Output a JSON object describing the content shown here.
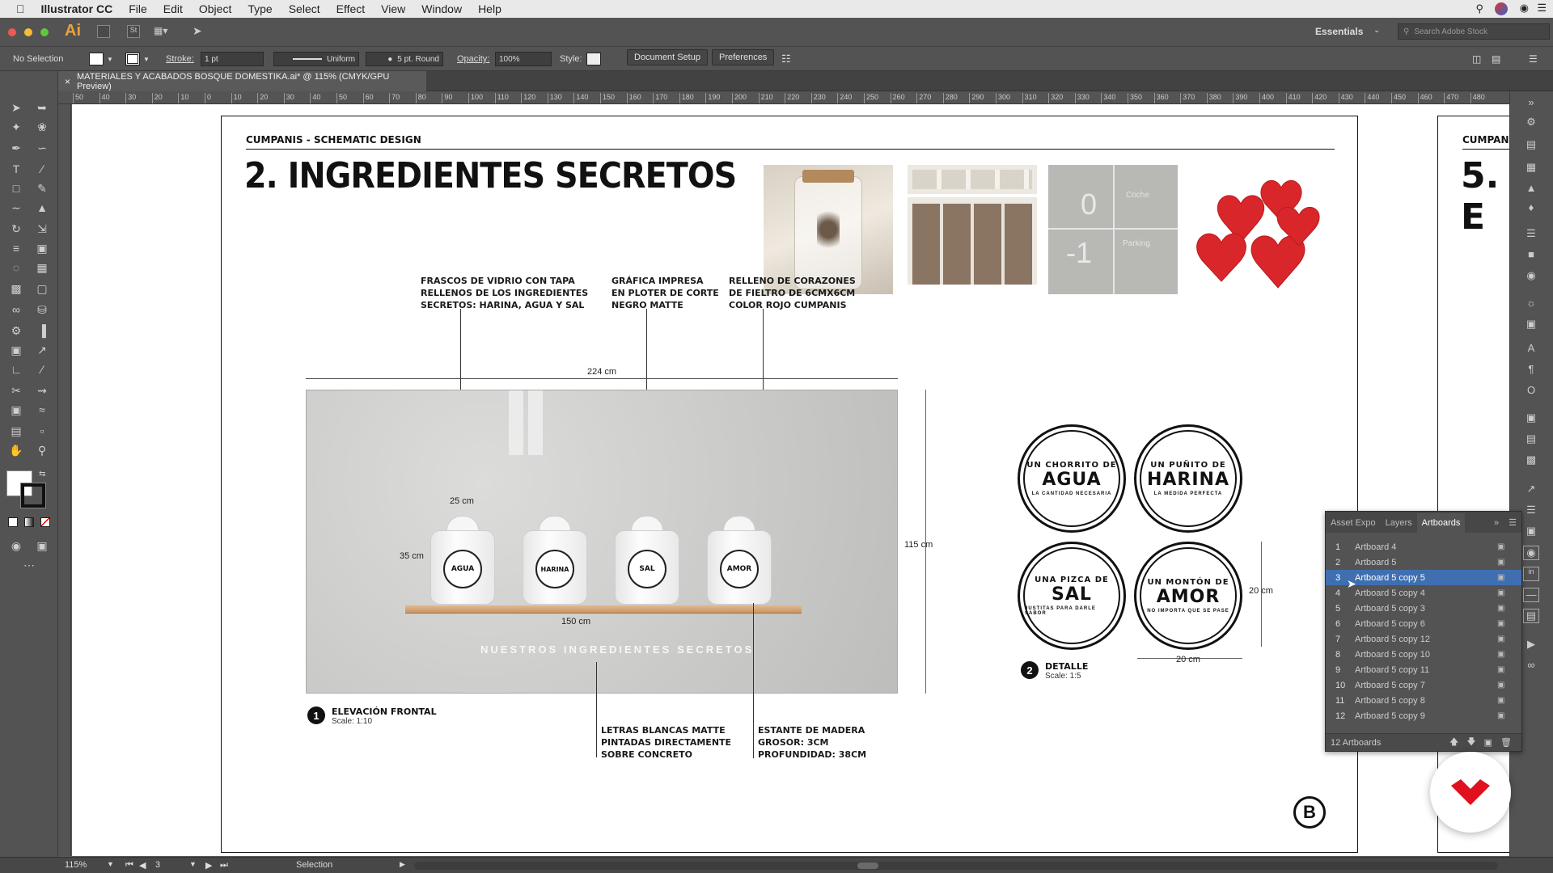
{
  "menubar": {
    "app": "Illustrator CC",
    "items": [
      "File",
      "Edit",
      "Object",
      "Type",
      "Select",
      "Effect",
      "View",
      "Window",
      "Help"
    ]
  },
  "appbar": {
    "logo": "Ai",
    "workspace": "Essentials",
    "search_placeholder": "Search Adobe Stock"
  },
  "control": {
    "selection": "No Selection",
    "stroke_label": "Stroke:",
    "stroke_value": "1 pt",
    "profile": "Uniform",
    "brush": "5 pt. Round",
    "opacity_label": "Opacity:",
    "opacity_value": "100%",
    "style_label": "Style:",
    "doc_setup": "Document Setup",
    "preferences": "Preferences"
  },
  "document": {
    "tab_title": "MATERIALES Y ACABADOS BOSQUE DOMESTIKA.ai* @ 115% (CMYK/GPU Preview)"
  },
  "ruler_ticks": [
    "50",
    "40",
    "30",
    "20",
    "10",
    "0",
    "10",
    "20",
    "30",
    "40",
    "50",
    "60",
    "70",
    "80",
    "90",
    "100",
    "110",
    "120",
    "130",
    "140",
    "150",
    "160",
    "170",
    "180",
    "190",
    "200",
    "210",
    "220",
    "230",
    "240",
    "250",
    "260",
    "270",
    "280",
    "290",
    "300",
    "310",
    "320",
    "330",
    "340",
    "350",
    "360",
    "370",
    "380",
    "390",
    "400",
    "410",
    "420",
    "430",
    "440",
    "450",
    "460",
    "470",
    "480"
  ],
  "artboard": {
    "project": "CUMPANIS - SCHEMATIC DESIGN",
    "title": "2. INGREDIENTES SECRETOS",
    "photo3_top": "0",
    "photo3_top_label": "Coche",
    "photo3_bottom": "-1",
    "photo3_bottom_label": "Parking",
    "notes": {
      "jars": [
        "FRASCOS DE VIDRIO CON TAPA",
        "RELLENOS DE LOS INGREDIENTES",
        "SECRETOS: HARINA, AGUA Y SAL"
      ],
      "graphic": [
        "GRÁFICA IMPRESA",
        "EN PLOTER DE CORTE",
        "NEGRO MATTE"
      ],
      "filling": [
        "RELLENO DE CORAZONES",
        "DE FIELTRO DE 6CMX6CM",
        "COLOR ROJO CUMPANIS"
      ],
      "letters": [
        "LETRAS BLANCAS MATTE",
        "PINTADAS DIRECTAMENTE",
        "SOBRE CONCRETO"
      ],
      "shelf": [
        "ESTANTE DE MADERA",
        "GROSOR: 3CM",
        "PROFUNDIDAD: 38CM"
      ]
    },
    "dims": {
      "width": "224 cm",
      "height": "115 cm",
      "jar_w": "25 cm",
      "jar_h": "35 cm",
      "shelf": "150 cm",
      "detail_h": "20 cm",
      "detail_w": "20 cm"
    },
    "wall_text": "NUESTROS INGREDIENTES SECRETOS",
    "jar_labels": [
      "AGUA",
      "HARINA",
      "SAL",
      "AMOR"
    ],
    "elevation": {
      "num": "1",
      "title": "ELEVACIÓN FRONTAL",
      "scale": "Scale: 1:10"
    },
    "detail": {
      "num": "2",
      "title": "DETALLE",
      "scale": "Scale: 1:5"
    },
    "stamps": [
      {
        "top": "UN CHORRITO DE",
        "word": "AGUA",
        "bottom": "LA CANTIDAD NECESARIA"
      },
      {
        "top": "UN PUÑITO DE",
        "word": "HARINA",
        "bottom": "LA MEDIDA PERFECTA"
      },
      {
        "top": "UNA PIZCA DE",
        "word": "SAL",
        "bottom": "JUSTITAS PARA DARLE SABOR"
      },
      {
        "top": "UN MONTÓN DE",
        "word": "AMOR",
        "bottom": "NO IMPORTA QUE SE PASE"
      }
    ],
    "logo": "B"
  },
  "artboard2": {
    "project": "CUMPANI",
    "title": "5. E"
  },
  "panel": {
    "tabs": [
      "Asset Expo",
      "Layers",
      "Artboards"
    ],
    "rows": [
      {
        "n": "1",
        "name": "Artboard 4"
      },
      {
        "n": "2",
        "name": "Artboard 5"
      },
      {
        "n": "3",
        "name": "Artboard 5 copy 5"
      },
      {
        "n": "4",
        "name": "Artboard 5 copy 4"
      },
      {
        "n": "5",
        "name": "Artboard 5 copy 3"
      },
      {
        "n": "6",
        "name": "Artboard 5 copy 6"
      },
      {
        "n": "7",
        "name": "Artboard 5 copy 12"
      },
      {
        "n": "8",
        "name": "Artboard 5 copy 10"
      },
      {
        "n": "9",
        "name": "Artboard 5 copy 11"
      },
      {
        "n": "10",
        "name": "Artboard 5 copy 7"
      },
      {
        "n": "11",
        "name": "Artboard 5 copy 8"
      },
      {
        "n": "12",
        "name": "Artboard 5 copy 9"
      }
    ],
    "footer": "12 Artboards"
  },
  "status": {
    "zoom": "115%",
    "artboard": "3",
    "tool": "Selection"
  },
  "colors": {
    "accent": "#e0101e",
    "selection": "#3f6fb0"
  }
}
